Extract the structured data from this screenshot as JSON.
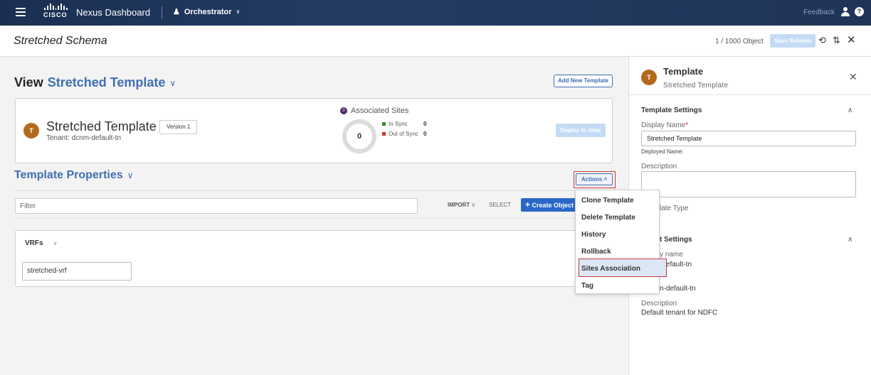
{
  "topbar": {
    "brand_word": "CISCO",
    "app_title": "Nexus Dashboard",
    "service_label": "Orchestrator",
    "service_icon": "orchestrator-icon",
    "feedback_label": "Feedback",
    "help_label": "?"
  },
  "header": {
    "title": "Stretched Schema",
    "object_count": "1 / 1000 Object",
    "save_label": "Save Schema",
    "icons": [
      "history-icon",
      "sync-icon",
      "close-icon"
    ]
  },
  "main": {
    "view_label": "View",
    "view_value": "Stretched Template",
    "add_template_label": "Add New Template",
    "template_card": {
      "avatar_letter": "T",
      "name": "Stretched Template",
      "tenant": "Tenant: dcnm-default-tn",
      "version": "Version 1",
      "associated_sites_label": "Associated Sites",
      "associated_sites_count": "0",
      "assoc_badge": "0",
      "in_sync_label": "In Sync",
      "in_sync_count": "0",
      "out_of_sync_label": "Out of Sync",
      "out_of_sync_count": "0",
      "deploy_label": "Deploy to sites"
    },
    "template_properties_label": "Template Properties",
    "actions_label": "Actions",
    "filter_placeholder": "Filter",
    "import_label": "IMPORT",
    "select_label": "SELECT",
    "create_object_label": "Create Object",
    "vrfs_label": "VRFs",
    "vrf_items": [
      "stretched-vrf"
    ]
  },
  "actions_menu": {
    "items": [
      "Clone Template",
      "Delete Template",
      "History",
      "Rollback",
      "Sites Association",
      "Tag"
    ],
    "highlighted": "Sites Association"
  },
  "right_panel": {
    "avatar_letter": "T",
    "title": "Template",
    "subtitle": "Stretched Template",
    "template_settings_label": "Template Settings",
    "display_name_label": "Display Name",
    "display_name_required": "*",
    "display_name_value": "Stretched Template",
    "deployed_name_label": "Deployed Name:",
    "description_label": "Description",
    "description_value": "",
    "template_type_partial": "late Type",
    "tenant_settings_partial": "t Settings",
    "tenant_display_name_partial": "y name",
    "tenant_display_value_partial": "-default-tn",
    "tenant_name_value_partial": "n-default-tn",
    "tenant_description_label": "Description",
    "tenant_description_value": "Default tenant for NDFC"
  },
  "colors": {
    "accent": "#3f6fb1",
    "navbar": "#1f3457",
    "highlight_border": "#c8383a",
    "in_sync": "#2e8b2e",
    "out_of_sync": "#d32f2f",
    "avatar": "#b26a1f"
  }
}
